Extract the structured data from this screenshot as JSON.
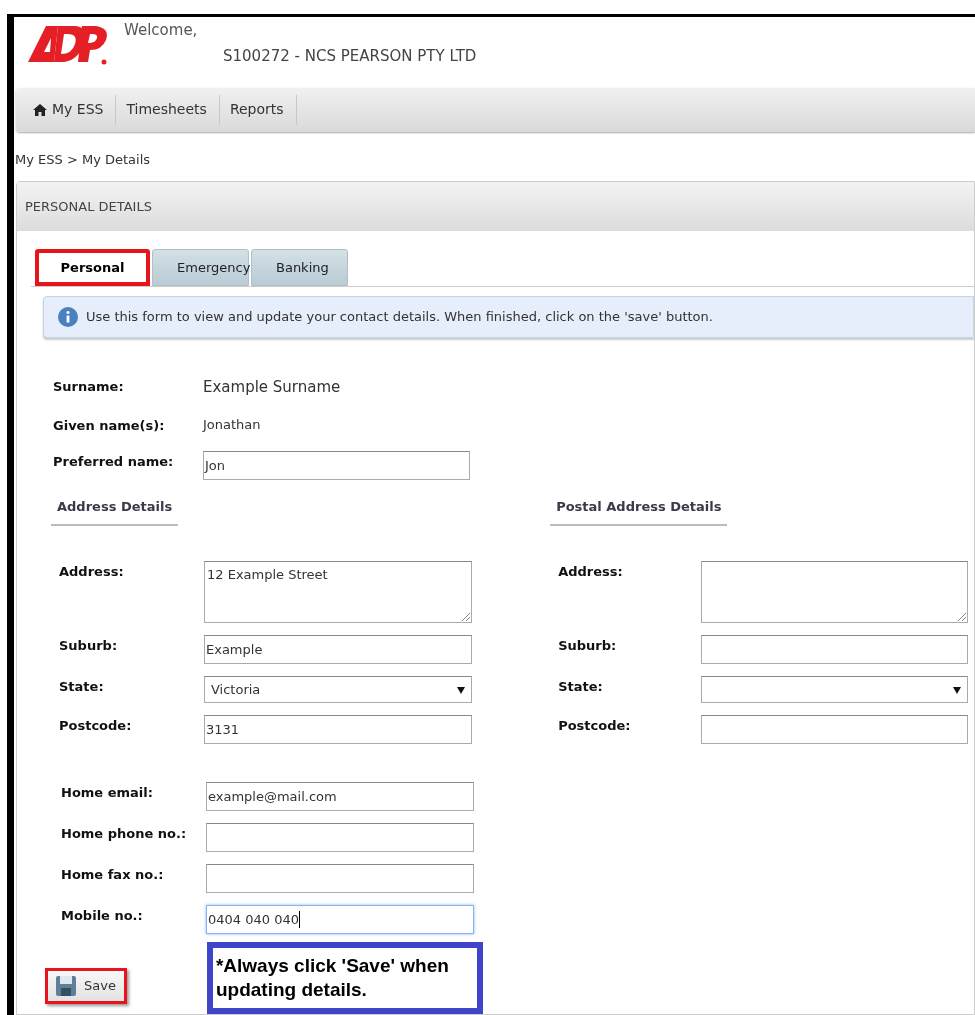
{
  "header": {
    "welcome": "Welcome,",
    "company": "S100272 - NCS PEARSON PTY LTD"
  },
  "nav": [
    {
      "label": "My ESS",
      "kind": "home"
    },
    {
      "label": "Timesheets",
      "kind": "link"
    },
    {
      "label": "Reports",
      "kind": "link"
    }
  ],
  "breadcrumb": "My ESS > My Details",
  "panel_title": "PERSONAL DETAILS",
  "tabs": [
    {
      "label": "Personal",
      "selected": true,
      "highlighted": true
    },
    {
      "label": "Emergency",
      "selected": false,
      "highlighted": false
    },
    {
      "label": "Banking",
      "selected": false,
      "highlighted": false
    }
  ],
  "info_message": "Use this form to view and update your contact details. When finished, click on the 'save' button.",
  "name_fields": [
    {
      "label": "Surname:",
      "kind": "large_text",
      "value": "Example Surname"
    },
    {
      "label": "Given name(s):",
      "kind": "text",
      "value": "Jonathan"
    },
    {
      "label": "Preferred name:",
      "kind": "input",
      "value": "Jon",
      "focused": false
    }
  ],
  "address_details": {
    "heading": "Address Details",
    "fields": [
      {
        "label": "Address:",
        "kind": "textarea",
        "value": "12 Example Street",
        "focused": false
      },
      {
        "label": "Suburb:",
        "kind": "input",
        "value": "Example",
        "focused": false
      },
      {
        "label": "State:",
        "kind": "select",
        "value": "Victoria",
        "focused": false
      },
      {
        "label": "Postcode:",
        "kind": "input",
        "value": "3131",
        "focused": false
      }
    ]
  },
  "postal_address_details": {
    "heading": "Postal Address Details",
    "fields": [
      {
        "label": "Address:",
        "kind": "textarea",
        "focused": false
      },
      {
        "label": "Suburb:",
        "kind": "input",
        "focused": false
      },
      {
        "label": "State:",
        "kind": "select",
        "focused": false
      },
      {
        "label": "Postcode:",
        "kind": "input",
        "focused": false
      }
    ]
  },
  "contact_fields": [
    {
      "label": "Home email:",
      "kind": "input",
      "value": "example@mail.com",
      "focused": false
    },
    {
      "label": "Home phone no.:",
      "kind": "input",
      "focused": false
    },
    {
      "label": "Home fax no.:",
      "kind": "input",
      "focused": false
    },
    {
      "label": "Mobile no.:",
      "kind": "input",
      "value": "0404 040 040",
      "focused": true
    }
  ],
  "save_button": {
    "label": "Save",
    "highlighted": true
  },
  "note": "*Always click 'Save' when updating details."
}
